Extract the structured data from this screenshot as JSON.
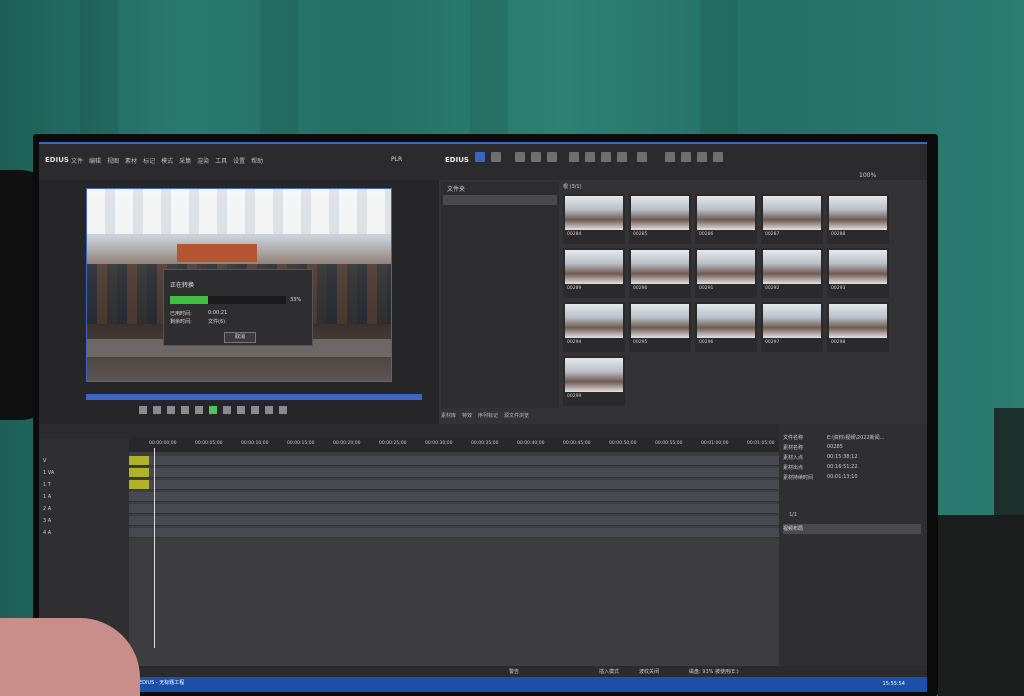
{
  "app": {
    "brand": "EDIUS",
    "recorder_brand": "EDIUS",
    "plr_label": "PLR",
    "zoom": "100%"
  },
  "player": {
    "dialog_title": "正在转换",
    "progress_percent": 33,
    "progress_text": "33%",
    "elapsed_label": "已用时间:",
    "elapsed_value": "0:00:21",
    "remain_label": "剩余时间:",
    "remain_value": "文件(6)",
    "cancel_label": "取消"
  },
  "bin": {
    "path": "根 (3/1)",
    "tree_header": "文件夹",
    "tabs": [
      "素材库",
      "特效",
      "序列标记",
      "源文件浏览"
    ],
    "thumbs": [
      "00284",
      "00285",
      "00286",
      "00287",
      "00288",
      "00289",
      "00290",
      "00291",
      "00292",
      "00293",
      "00294",
      "00295",
      "00296",
      "00297",
      "00298",
      "00299"
    ]
  },
  "timeline": {
    "ruler_ticks": [
      "00:00:00;00",
      "00:00:05;00",
      "00:00:10;00",
      "00:00:15;00",
      "00:00:20;00",
      "00:00:25;00",
      "00:00:30;00",
      "00:00:35;00",
      "00:00:40;00",
      "00:00:45;00",
      "00:00:50;00",
      "00:00:55;00",
      "00:01:00;00",
      "00:01:05;00"
    ],
    "tracks": [
      "V",
      "1 VA",
      "1 T",
      "1 A",
      "2 A",
      "3 A",
      "4 A"
    ]
  },
  "properties": {
    "rows": [
      {
        "label": "文件名称",
        "value": "E:\\资料\\视频\\2022新闻..."
      },
      {
        "label": "素材名称",
        "value": "00285"
      },
      {
        "label": "素材入点",
        "value": "00:15:38;12"
      },
      {
        "label": "素材出点",
        "value": "00:16:51;22"
      },
      {
        "label": "素材持续时间",
        "value": "00:01:13;10"
      }
    ],
    "page_count": "1/1",
    "effect": "视频布局"
  },
  "status": {
    "insert_mode": "插入模式",
    "ripple": "波纹关闭",
    "disk": "磁盘: 93% 被使用(E:)",
    "label": "警告"
  },
  "taskbar": {
    "task": "EDIUS - 无标题工程",
    "time": "15:55:54"
  }
}
